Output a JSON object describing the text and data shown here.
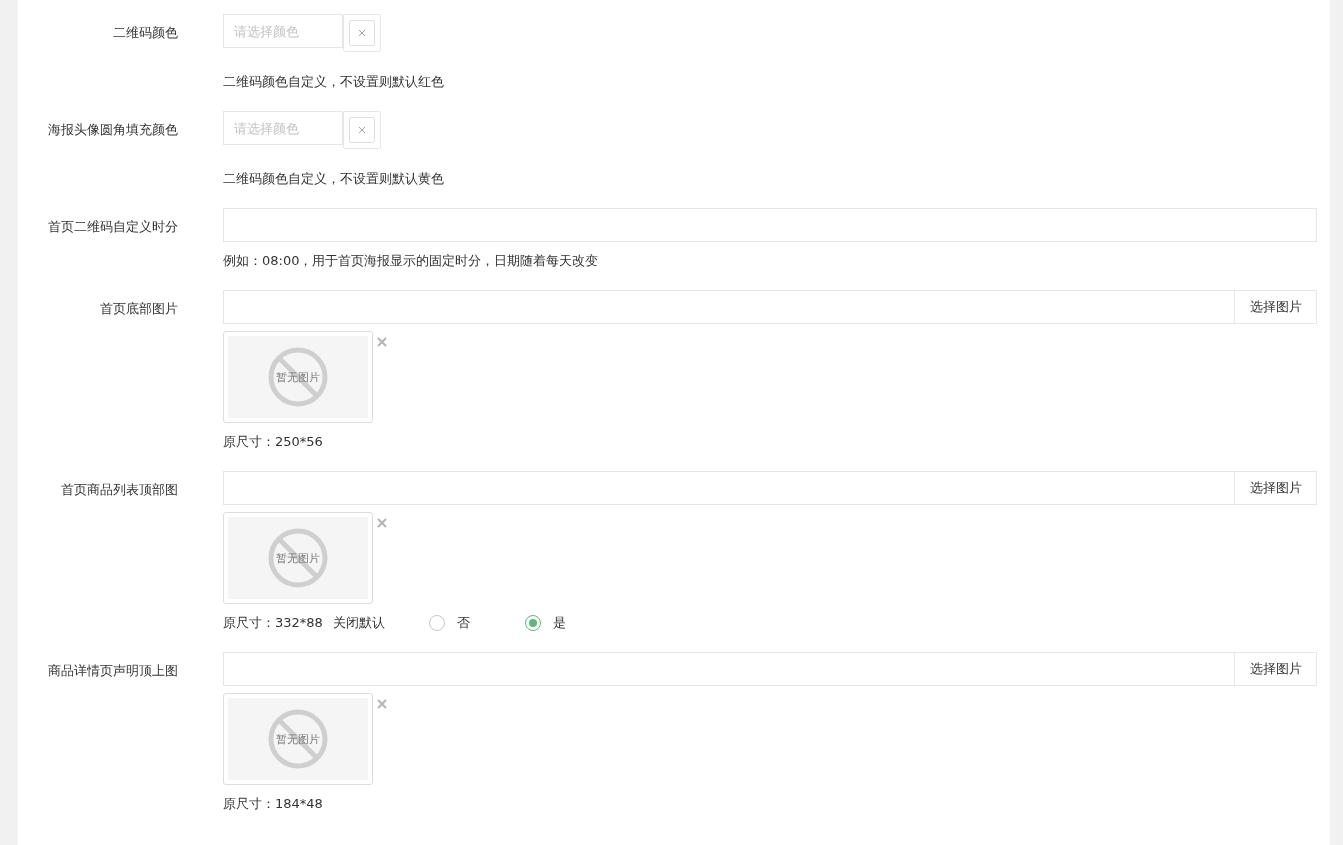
{
  "fields": [
    {
      "kind": "color",
      "label": "二维码颜色",
      "placeholder": "请选择颜色",
      "help": "二维码颜色自定义，不设置则默认红色"
    },
    {
      "kind": "color",
      "label": "海报头像圆角填充颜色",
      "placeholder": "请选择颜色",
      "help": "二维码颜色自定义，不设置则默认黄色"
    },
    {
      "kind": "text",
      "label": "首页二维码自定义时分",
      "help": "例如：08:00，用于首页海报显示的固定时分，日期随着每天改变"
    },
    {
      "kind": "image",
      "label": "首页底部图片",
      "button": "选择图片",
      "empty_text": "暂无图片",
      "help": "原尺寸：250*56"
    },
    {
      "kind": "image",
      "label": "首页商品列表顶部图",
      "button": "选择图片",
      "empty_text": "暂无图片",
      "help": "原尺寸：332*88",
      "radio": {
        "label": "关闭默认",
        "options": [
          {
            "label": "否",
            "selected": false
          },
          {
            "label": "是",
            "selected": true
          }
        ]
      }
    },
    {
      "kind": "image",
      "label": "商品详情页声明顶上图",
      "button": "选择图片",
      "empty_text": "暂无图片",
      "help": "原尺寸：184*48"
    }
  ]
}
